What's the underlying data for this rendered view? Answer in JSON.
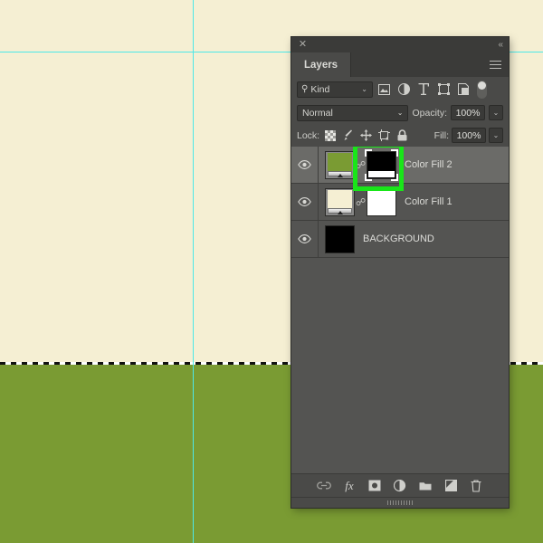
{
  "canvas": {
    "top_fill_color": "#F5EFD3",
    "bottom_fill_color": "#7A9B33",
    "guide_color": "#4DE8E8",
    "selection_style": "marching-ants-dashed"
  },
  "panel": {
    "titlebar": {
      "close_label": "✕",
      "collapse_label": "«"
    },
    "tab": {
      "label": "Layers"
    },
    "filter": {
      "kind_label": "Kind",
      "search_glyph": "⚲",
      "chevron": "⌄",
      "icons": [
        "pixel-layer-filter-icon",
        "adjustment-layer-filter-icon",
        "type-layer-filter-icon",
        "shape-layer-filter-icon",
        "smart-object-filter-icon"
      ],
      "toggle_name": "filter-enable-toggle"
    },
    "blend": {
      "mode": "Normal",
      "chevron": "⌄",
      "opacity_label": "Opacity:",
      "opacity_value": "100%"
    },
    "lock": {
      "label": "Lock:",
      "icons": [
        "lock-transparent-pixels-icon",
        "lock-image-pixels-icon",
        "lock-position-icon",
        "lock-artboard-nesting-icon",
        "lock-all-icon"
      ],
      "fill_label": "Fill:",
      "fill_value": "100%"
    },
    "layers": [
      {
        "name": "Color Fill 2",
        "visible": true,
        "selected": true,
        "thumb_color": "#7A9B33",
        "has_link": true,
        "mask": "black",
        "mask_active": true,
        "highlighted": true
      },
      {
        "name": "Color Fill 1",
        "visible": true,
        "selected": false,
        "thumb_color": "#F5EFD3",
        "has_link": true,
        "mask": "white",
        "mask_active": false,
        "highlighted": false
      },
      {
        "name": "BACKGROUND",
        "visible": true,
        "selected": false,
        "thumb_color": "#000000",
        "has_link": false,
        "mask": "none",
        "mask_active": false,
        "highlighted": false
      }
    ],
    "bottom_toolbar": {
      "icons": [
        "link-layers-icon",
        "layer-style-fx-icon",
        "add-layer-mask-icon",
        "new-adjustment-layer-icon",
        "new-group-icon",
        "new-layer-icon",
        "delete-layer-icon"
      ],
      "fx_label": "fx"
    },
    "annotation": {
      "highlight_color": "#19E619",
      "target": "layer-mask-thumbnail"
    }
  }
}
